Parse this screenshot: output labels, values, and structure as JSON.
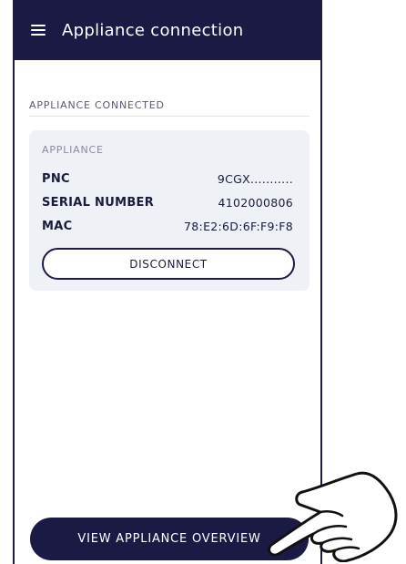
{
  "header": {
    "menu_icon": "hamburger-menu-icon",
    "title": "Appliance connection"
  },
  "section": {
    "label": "APPLIANCE CONNECTED"
  },
  "card": {
    "caption": "APPLIANCE",
    "rows": [
      {
        "label": "PNC",
        "value": "9CGX..........."
      },
      {
        "label": "SERIAL NUMBER",
        "value": "4102000806"
      },
      {
        "label": "MAC",
        "value": "78:E2:6D:6F:F9:F8"
      }
    ],
    "disconnect_label": "DISCONNECT"
  },
  "footer": {
    "primary_label": "VIEW APPLIANCE OVERVIEW",
    "pointer_icon": "pointing-hand-icon"
  },
  "colors": {
    "header_bg": "#1b1a45",
    "card_bg": "#eef1f6",
    "primary_button": "#1b1a45"
  }
}
